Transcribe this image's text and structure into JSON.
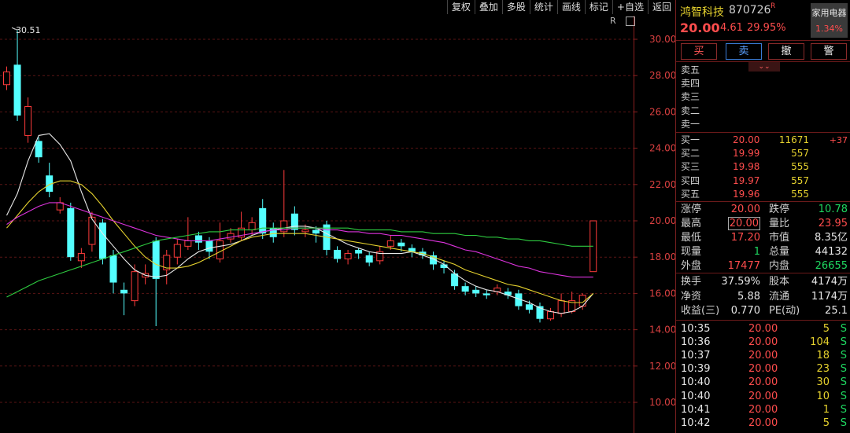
{
  "toolbar": {
    "items": [
      "复权",
      "叠加",
      "多股",
      "统计",
      "画线",
      "标记",
      "+自选",
      "返回"
    ],
    "restore": "R"
  },
  "stock": {
    "name": "鸿智科技",
    "code": "870726",
    "code_mark": "R",
    "price": "20.00",
    "change": "4.61",
    "change_pct": "29.95%",
    "sector": "家用电器",
    "sector_pct": "1.34%"
  },
  "trade_buttons": [
    "买",
    "卖",
    "撤",
    "警"
  ],
  "ask": [
    {
      "label": "卖五"
    },
    {
      "label": "卖四"
    },
    {
      "label": "卖三"
    },
    {
      "label": "卖二"
    },
    {
      "label": "卖一"
    }
  ],
  "bid": [
    {
      "label": "买一",
      "price": "20.00",
      "vol": "11671",
      "diff": "+37"
    },
    {
      "label": "买二",
      "price": "19.99",
      "vol": "557",
      "diff": ""
    },
    {
      "label": "买三",
      "price": "19.98",
      "vol": "555",
      "diff": ""
    },
    {
      "label": "买四",
      "price": "19.97",
      "vol": "557",
      "diff": ""
    },
    {
      "label": "买五",
      "price": "19.96",
      "vol": "555",
      "diff": ""
    }
  ],
  "stats": [
    [
      {
        "l": "涨停",
        "v": "20.00",
        "c": "red"
      },
      {
        "l": "跌停",
        "v": "10.78",
        "c": "grn"
      }
    ],
    [
      {
        "l": "最高",
        "v": "20.00",
        "c": "red",
        "box": true
      },
      {
        "l": "量比",
        "v": "23.95",
        "c": "red"
      }
    ],
    [
      {
        "l": "最低",
        "v": "17.20",
        "c": "red"
      },
      {
        "l": "市值",
        "v": "8.35亿",
        "c": "wht"
      }
    ],
    [
      {
        "l": "现量",
        "v": "1",
        "c": "grn"
      },
      {
        "l": "总量",
        "v": "44132",
        "c": "wht"
      }
    ],
    [
      {
        "l": "外盘",
        "v": "17477",
        "c": "red"
      },
      {
        "l": "内盘",
        "v": "26655",
        "c": "grn"
      }
    ],
    [
      {
        "l": "换手",
        "v": "37.59%",
        "c": "wht"
      },
      {
        "l": "股本",
        "v": "4174万",
        "c": "wht"
      }
    ],
    [
      {
        "l": "净资",
        "v": "5.88",
        "c": "wht"
      },
      {
        "l": "流通",
        "v": "1174万",
        "c": "wht"
      }
    ],
    [
      {
        "l": "收益(三)",
        "v": "0.770",
        "c": "wht"
      },
      {
        "l": "PE(动)",
        "v": "25.1",
        "c": "wht"
      }
    ]
  ],
  "ticks": [
    {
      "t": "10:35",
      "p": "20.00",
      "v": "5",
      "s": "S"
    },
    {
      "t": "10:36",
      "p": "20.00",
      "v": "104",
      "s": "S"
    },
    {
      "t": "10:37",
      "p": "20.00",
      "v": "18",
      "s": "S"
    },
    {
      "t": "10:39",
      "p": "20.00",
      "v": "23",
      "s": "S"
    },
    {
      "t": "10:40",
      "p": "20.00",
      "v": "30",
      "s": "S"
    },
    {
      "t": "10:40",
      "p": "20.00",
      "v": "10",
      "s": "S"
    },
    {
      "t": "10:41",
      "p": "20.00",
      "v": "1",
      "s": "S"
    },
    {
      "t": "10:42",
      "p": "20.00",
      "v": "5",
      "s": "S"
    }
  ],
  "chart_data": {
    "type": "candlestick",
    "y_ticks": [
      "30.00",
      "28.00",
      "26.00",
      "24.00",
      "22.00",
      "20.00",
      "18.00",
      "16.00",
      "14.00",
      "12.00",
      "10.00"
    ],
    "ylim": [
      9.6,
      31.3
    ],
    "max_label": "30.51",
    "grid": "dashed horizontal",
    "candles": [
      {
        "o": 27.5,
        "c": 28.2,
        "h": 28.5,
        "l": 27.2
      },
      {
        "o": 28.6,
        "c": 25.8,
        "h": 30.5,
        "l": 25.5
      },
      {
        "o": 24.7,
        "c": 26.3,
        "h": 26.8,
        "l": 24.3
      },
      {
        "o": 24.4,
        "c": 23.5,
        "h": 24.6,
        "l": 23.2
      },
      {
        "o": 22.5,
        "c": 21.6,
        "h": 23.2,
        "l": 21.3
      },
      {
        "o": 20.6,
        "c": 21.0,
        "h": 21.3,
        "l": 20.4
      },
      {
        "o": 20.7,
        "c": 18.0,
        "h": 21.0,
        "l": 17.8
      },
      {
        "o": 17.8,
        "c": 18.2,
        "h": 18.5,
        "l": 17.4
      },
      {
        "o": 18.7,
        "c": 20.2,
        "h": 20.5,
        "l": 18.3
      },
      {
        "o": 19.9,
        "c": 17.9,
        "h": 20.1,
        "l": 17.6
      },
      {
        "o": 18.1,
        "c": 16.6,
        "h": 18.4,
        "l": 16.0
      },
      {
        "o": 16.2,
        "c": 16.0,
        "h": 16.6,
        "l": 14.8
      },
      {
        "o": 15.6,
        "c": 17.2,
        "h": 17.6,
        "l": 15.3
      },
      {
        "o": 16.9,
        "c": 17.1,
        "h": 17.6,
        "l": 16.5
      },
      {
        "o": 18.9,
        "c": 16.8,
        "h": 19.1,
        "l": 14.2
      },
      {
        "o": 17.3,
        "c": 18.1,
        "h": 18.4,
        "l": 16.5
      },
      {
        "o": 18.0,
        "c": 18.7,
        "h": 19.0,
        "l": 17.6
      },
      {
        "o": 18.6,
        "c": 18.9,
        "h": 20.2,
        "l": 18.4
      },
      {
        "o": 19.2,
        "c": 18.8,
        "h": 19.4,
        "l": 18.4
      },
      {
        "o": 18.9,
        "c": 18.3,
        "h": 19.1,
        "l": 17.9
      },
      {
        "o": 17.9,
        "c": 18.9,
        "h": 19.9,
        "l": 17.7
      },
      {
        "o": 19.0,
        "c": 19.3,
        "h": 19.6,
        "l": 18.8
      },
      {
        "o": 19.1,
        "c": 19.6,
        "h": 20.5,
        "l": 18.9
      },
      {
        "o": 19.5,
        "c": 19.9,
        "h": 20.2,
        "l": 19.2
      },
      {
        "o": 20.7,
        "c": 19.3,
        "h": 21.2,
        "l": 19.0
      },
      {
        "o": 19.6,
        "c": 19.1,
        "h": 19.9,
        "l": 18.8
      },
      {
        "o": 19.4,
        "c": 20.0,
        "h": 22.8,
        "l": 19.1
      },
      {
        "o": 20.4,
        "c": 19.5,
        "h": 20.8,
        "l": 19.2
      },
      {
        "o": 19.4,
        "c": 19.5,
        "h": 19.8,
        "l": 19.1
      },
      {
        "o": 19.5,
        "c": 19.3,
        "h": 19.7,
        "l": 18.8
      },
      {
        "o": 19.8,
        "c": 18.4,
        "h": 20.0,
        "l": 18.1
      },
      {
        "o": 18.4,
        "c": 17.9,
        "h": 18.6,
        "l": 17.7
      },
      {
        "o": 17.9,
        "c": 18.2,
        "h": 18.4,
        "l": 17.6
      },
      {
        "o": 18.4,
        "c": 18.2,
        "h": 18.5,
        "l": 17.9
      },
      {
        "o": 18.1,
        "c": 17.7,
        "h": 18.3,
        "l": 17.5
      },
      {
        "o": 17.8,
        "c": 18.3,
        "h": 18.6,
        "l": 17.6
      },
      {
        "o": 18.6,
        "c": 18.9,
        "h": 19.2,
        "l": 18.4
      },
      {
        "o": 18.8,
        "c": 18.6,
        "h": 19.0,
        "l": 18.3
      },
      {
        "o": 18.5,
        "c": 18.3,
        "h": 18.7,
        "l": 18.0
      },
      {
        "o": 18.3,
        "c": 18.1,
        "h": 18.5,
        "l": 17.9
      },
      {
        "o": 18.1,
        "c": 17.6,
        "h": 18.3,
        "l": 17.3
      },
      {
        "o": 17.6,
        "c": 17.4,
        "h": 17.8,
        "l": 17.1
      },
      {
        "o": 17.1,
        "c": 16.4,
        "h": 17.3,
        "l": 16.2
      },
      {
        "o": 16.4,
        "c": 16.1,
        "h": 16.6,
        "l": 15.9
      },
      {
        "o": 16.2,
        "c": 16.0,
        "h": 16.4,
        "l": 15.8
      },
      {
        "o": 16.0,
        "c": 15.9,
        "h": 16.2,
        "l": 15.7
      },
      {
        "o": 16.1,
        "c": 16.3,
        "h": 16.5,
        "l": 15.9
      },
      {
        "o": 16.1,
        "c": 15.9,
        "h": 16.3,
        "l": 15.7
      },
      {
        "o": 16.0,
        "c": 15.3,
        "h": 16.2,
        "l": 15.1
      },
      {
        "o": 15.4,
        "c": 15.1,
        "h": 15.6,
        "l": 14.9
      },
      {
        "o": 15.3,
        "c": 14.6,
        "h": 15.5,
        "l": 14.4
      },
      {
        "o": 14.6,
        "c": 15.0,
        "h": 15.2,
        "l": 14.5
      },
      {
        "o": 14.9,
        "c": 15.6,
        "h": 16.0,
        "l": 14.7
      },
      {
        "o": 15.0,
        "c": 15.6,
        "h": 16.1,
        "l": 14.9
      },
      {
        "o": 15.3,
        "c": 15.9,
        "h": 16.0,
        "l": 15.1
      },
      {
        "o": 17.2,
        "c": 20.0,
        "h": 20.0,
        "l": 17.2
      }
    ],
    "ma_series": [
      {
        "color": "#e8e8e8",
        "values": [
          20.3,
          21.5,
          23.3,
          24.7,
          24.8,
          24.2,
          23.3,
          21.6,
          20.1,
          19.3,
          18.6,
          17.9,
          17.3,
          17.0,
          16.9,
          17.0,
          17.4,
          17.9,
          18.3,
          18.5,
          18.6,
          18.7,
          18.9,
          19.2,
          19.4,
          19.5,
          19.6,
          19.7,
          19.7,
          19.6,
          19.3,
          19.0,
          18.7,
          18.5,
          18.3,
          18.2,
          18.2,
          18.2,
          18.3,
          18.1,
          17.9,
          17.6,
          17.1,
          16.7,
          16.4,
          16.2,
          16.1,
          15.9,
          15.7,
          15.5,
          15.2,
          15.0,
          14.9,
          15.0,
          15.3,
          16.0
        ]
      },
      {
        "color": "#e6d22e",
        "values": [
          19.6,
          20.3,
          21.0,
          21.6,
          22.0,
          22.2,
          22.2,
          22.0,
          21.5,
          20.8,
          20.0,
          19.3,
          18.6,
          18.0,
          17.6,
          17.4,
          17.4,
          17.5,
          17.7,
          18.0,
          18.3,
          18.6,
          18.9,
          19.1,
          19.2,
          19.3,
          19.3,
          19.3,
          19.3,
          19.2,
          19.1,
          19.0,
          18.9,
          18.8,
          18.7,
          18.6,
          18.5,
          18.4,
          18.3,
          18.2,
          18.0,
          17.8,
          17.6,
          17.3,
          17.1,
          16.9,
          16.7,
          16.5,
          16.4,
          16.2,
          16.0,
          15.8,
          15.6,
          15.5,
          15.5,
          16.0
        ]
      },
      {
        "color": "#dd33dd",
        "values": [
          19.8,
          20.2,
          20.5,
          20.8,
          21.0,
          21.0,
          20.8,
          20.6,
          20.4,
          20.2,
          20.0,
          19.8,
          19.6,
          19.4,
          19.2,
          19.1,
          19.0,
          18.9,
          18.9,
          18.9,
          19.0,
          19.1,
          19.2,
          19.3,
          19.4,
          19.5,
          19.5,
          19.6,
          19.6,
          19.6,
          19.5,
          19.5,
          19.4,
          19.4,
          19.3,
          19.3,
          19.2,
          19.2,
          19.1,
          19.0,
          18.9,
          18.8,
          18.6,
          18.4,
          18.3,
          18.1,
          17.9,
          17.7,
          17.5,
          17.4,
          17.2,
          17.1,
          17.0,
          16.9,
          16.9,
          16.9
        ]
      },
      {
        "color": "#2ecc40",
        "values": [
          15.8,
          16.1,
          16.4,
          16.7,
          16.9,
          17.1,
          17.3,
          17.5,
          17.7,
          17.9,
          18.1,
          18.3,
          18.5,
          18.7,
          18.9,
          19.0,
          19.1,
          19.2,
          19.3,
          19.4,
          19.4,
          19.5,
          19.5,
          19.5,
          19.6,
          19.6,
          19.6,
          19.6,
          19.6,
          19.6,
          19.6,
          19.6,
          19.6,
          19.5,
          19.5,
          19.5,
          19.5,
          19.4,
          19.4,
          19.4,
          19.3,
          19.3,
          19.3,
          19.2,
          19.2,
          19.1,
          19.1,
          19.0,
          19.0,
          18.9,
          18.9,
          18.8,
          18.7,
          18.6,
          18.6,
          18.6
        ]
      }
    ]
  }
}
